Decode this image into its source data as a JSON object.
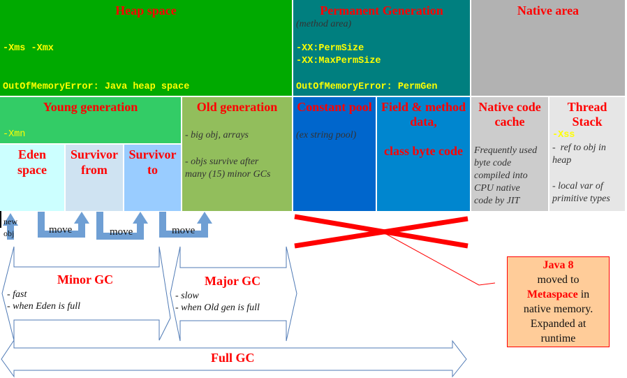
{
  "heap": {
    "title": "Heap space",
    "flags": "-Xms -Xmx",
    "error": "OutOfMemoryError: Java heap space",
    "color": "#00aa00"
  },
  "permgen": {
    "title": "Permanent Generation",
    "subtitle": "(method area)",
    "flag1": "-XX:PermSize",
    "flag2": "-XX:MaxPermSize",
    "error": "OutOfMemoryError: PermGen",
    "color": "#007f7f"
  },
  "native": {
    "title": "Native area",
    "color": "#b2b2b2"
  },
  "young": {
    "title": "Young generation",
    "flag": "-Xmn",
    "color": "#33cc66",
    "eden": {
      "line1": "Eden",
      "line2": "space",
      "color": "#ccffff"
    },
    "survivor_from": {
      "line1": "Survivor",
      "line2": "from",
      "color": "#cfe3f2"
    },
    "survivor_to": {
      "line1": "Survivor",
      "line2": "to",
      "color": "#99ccff"
    }
  },
  "old": {
    "title": "Old generation",
    "note1": "- big obj, arrays",
    "note2a": "- objs survive after",
    "note2b": "many (15) minor GCs",
    "color": "#92be5c"
  },
  "constant_pool": {
    "title": "Constant pool",
    "note": "(ex string pool)",
    "color": "#0066cc"
  },
  "field_method": {
    "title1": "Field & method",
    "title2": "data,",
    "title3": "class byte code",
    "color": "#0086cf"
  },
  "native_code_cache": {
    "title1": "Native code",
    "title2": "cache",
    "notes": [
      "Frequently used",
      "byte code",
      "compiled into",
      "CPU native",
      "code by JIT"
    ],
    "color": "#cccccc"
  },
  "thread_stack": {
    "title1": "Thread",
    "title2": "Stack",
    "flag": "-Xss",
    "note1a": "-  ref to obj in",
    "note1b": "heap",
    "note2a": "- local var of",
    "note2b": "primitive types",
    "color": "#e6e6e6"
  },
  "arrows": {
    "new_obj_line1": "new",
    "new_obj_line2": "obj",
    "move_labels": [
      "move",
      "move",
      "move"
    ],
    "arrow_color": "#6f9fd4"
  },
  "gc": {
    "minor": {
      "title": "Minor GC",
      "note1": "- fast",
      "note2": "- when Eden is full"
    },
    "major": {
      "title": "Major GC",
      "note1": "- slow",
      "note2": "- when Old gen is full"
    },
    "full": {
      "title": "Full GC"
    },
    "outline_color": "#4f7ab5"
  },
  "callout": {
    "line1": "Java 8",
    "line2": "moved to",
    "line3_bold": "Metaspace",
    "line3_rest": " in",
    "line4": "native memory.",
    "line5": "Expanded at",
    "line6": "runtime",
    "bg": "#ffcc99",
    "border": "#ff0000"
  }
}
